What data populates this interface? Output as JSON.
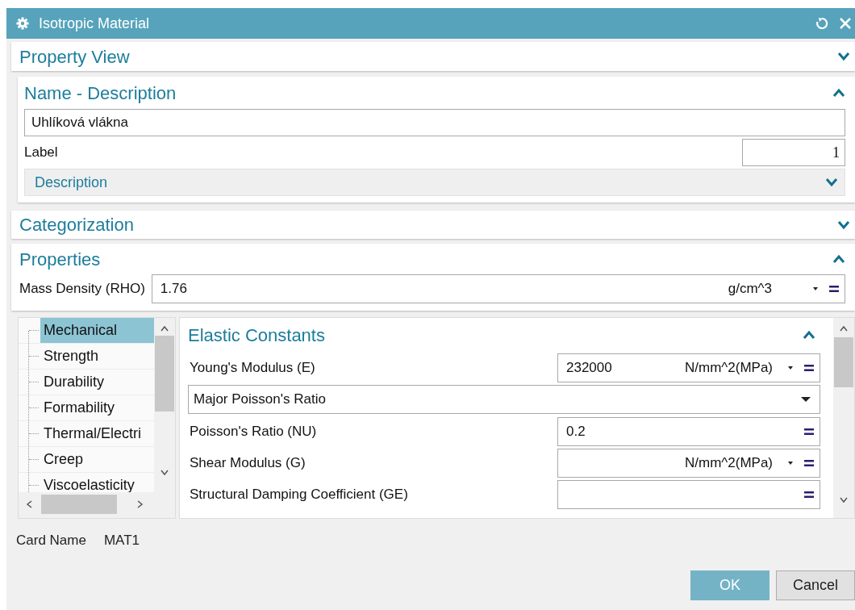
{
  "window": {
    "title": "Isotropic Material"
  },
  "property_view": {
    "title": "Property View",
    "expanded": false
  },
  "name_description": {
    "title": "Name - Description",
    "expanded": true,
    "name_value": "Uhlíková vlákna",
    "label_field": {
      "label": "Label",
      "value": "1"
    },
    "description": {
      "title": "Description",
      "expanded": false
    }
  },
  "categorization": {
    "title": "Categorization",
    "expanded": false
  },
  "properties": {
    "title": "Properties",
    "expanded": true,
    "mass_density": {
      "label": "Mass Density (RHO)",
      "value": "1.76",
      "unit": "g/cm^3"
    }
  },
  "tree": {
    "items": [
      {
        "label": "Mechanical",
        "selected": true
      },
      {
        "label": "Strength",
        "selected": false
      },
      {
        "label": "Durability",
        "selected": false
      },
      {
        "label": "Formability",
        "selected": false
      },
      {
        "label": "Thermal/Electri",
        "selected": false
      },
      {
        "label": "Creep",
        "selected": false
      },
      {
        "label": "Viscoelasticity",
        "selected": false
      }
    ]
  },
  "elastic_constants": {
    "title": "Elastic Constants",
    "expanded": true,
    "rows": [
      {
        "kind": "field",
        "label": "Young's Modulus (E)",
        "value": "232000",
        "unit": "N/mm^2(MPa)"
      },
      {
        "kind": "dropdown",
        "value": "Major Poisson's Ratio"
      },
      {
        "kind": "field",
        "label": "Poisson's Ratio (NU)",
        "value": "0.2"
      },
      {
        "kind": "field",
        "label": "Shear Modulus (G)",
        "unit": "N/mm^2(MPa)"
      },
      {
        "kind": "field",
        "label": "Structural Damping Coefficient (GE)"
      }
    ]
  },
  "card_name": {
    "label": "Card Name",
    "value": "MAT1"
  },
  "buttons": [
    {
      "label": "OK",
      "kind": "primary"
    },
    {
      "label": "Cancel",
      "kind": "secondary"
    }
  ]
}
